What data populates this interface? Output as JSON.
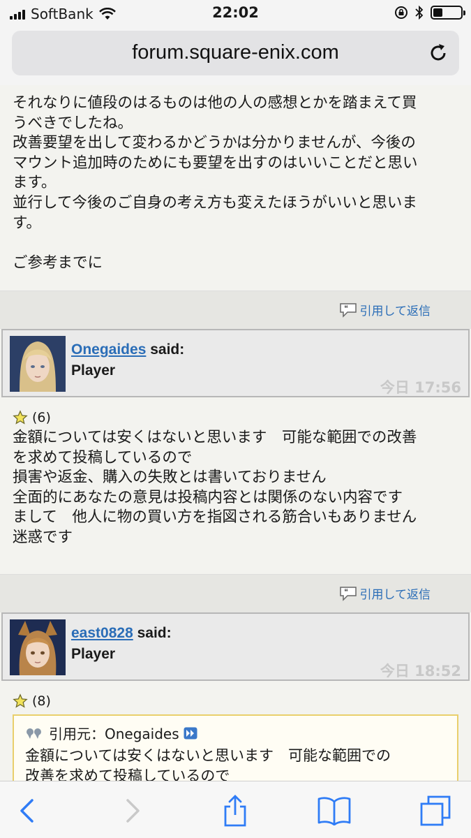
{
  "status_bar": {
    "carrier": "SoftBank",
    "time": "22:02",
    "battery_level": 0.35
  },
  "browser": {
    "url": "forum.square-enix.com"
  },
  "posts": {
    "post1_text": "それなりに値段のはるものは他の人の感想とかを踏まえて買\nうべきでしたね。\n改善要望を出して変わるかどうかは分かりませんが、今後の\nマウント追加時のためにも要望を出すのはいいことだと思い\nます。\n並行して今後のご自身の考え方も変えたほうがいいと思いま\nす。\n\nご参考までに",
    "reply_label": "引用して返信",
    "post2": {
      "username": "Onegaides",
      "said": "said:",
      "role": "Player",
      "time": "今日 17:56",
      "rating": "(6)",
      "text": "金額については安くはないと思います　可能な範囲での改善\nを求めて投稿しているので\n損害や返金、購入の失敗とは書いておりません\n全面的にあなたの意見は投稿内容とは関係のない内容です\nまして　他人に物の買い方を指図される筋合いもありません\n迷惑です"
    },
    "post3": {
      "username": "east0828",
      "said": "said:",
      "role": "Player",
      "time": "今日 18:52",
      "rating": "(8)",
      "quote_label": "引用元：Onegaides",
      "quote_text": "金額については安くはないと思います　可能な範囲での\n改善を求めて投稿しているので"
    }
  },
  "colors": {
    "link": "#2a6db7",
    "quote_border": "#e9cf6b",
    "toolbar_icon": "#2f7cf6"
  },
  "icons": [
    "signal-icon",
    "wifi-icon",
    "lock-rotation-icon",
    "bluetooth-icon",
    "battery-icon",
    "reload-icon",
    "quote-reply-icon",
    "star-icon",
    "quote-icon",
    "view-post-icon",
    "back-icon",
    "forward-icon",
    "share-icon",
    "bookmarks-icon",
    "tabs-icon"
  ]
}
